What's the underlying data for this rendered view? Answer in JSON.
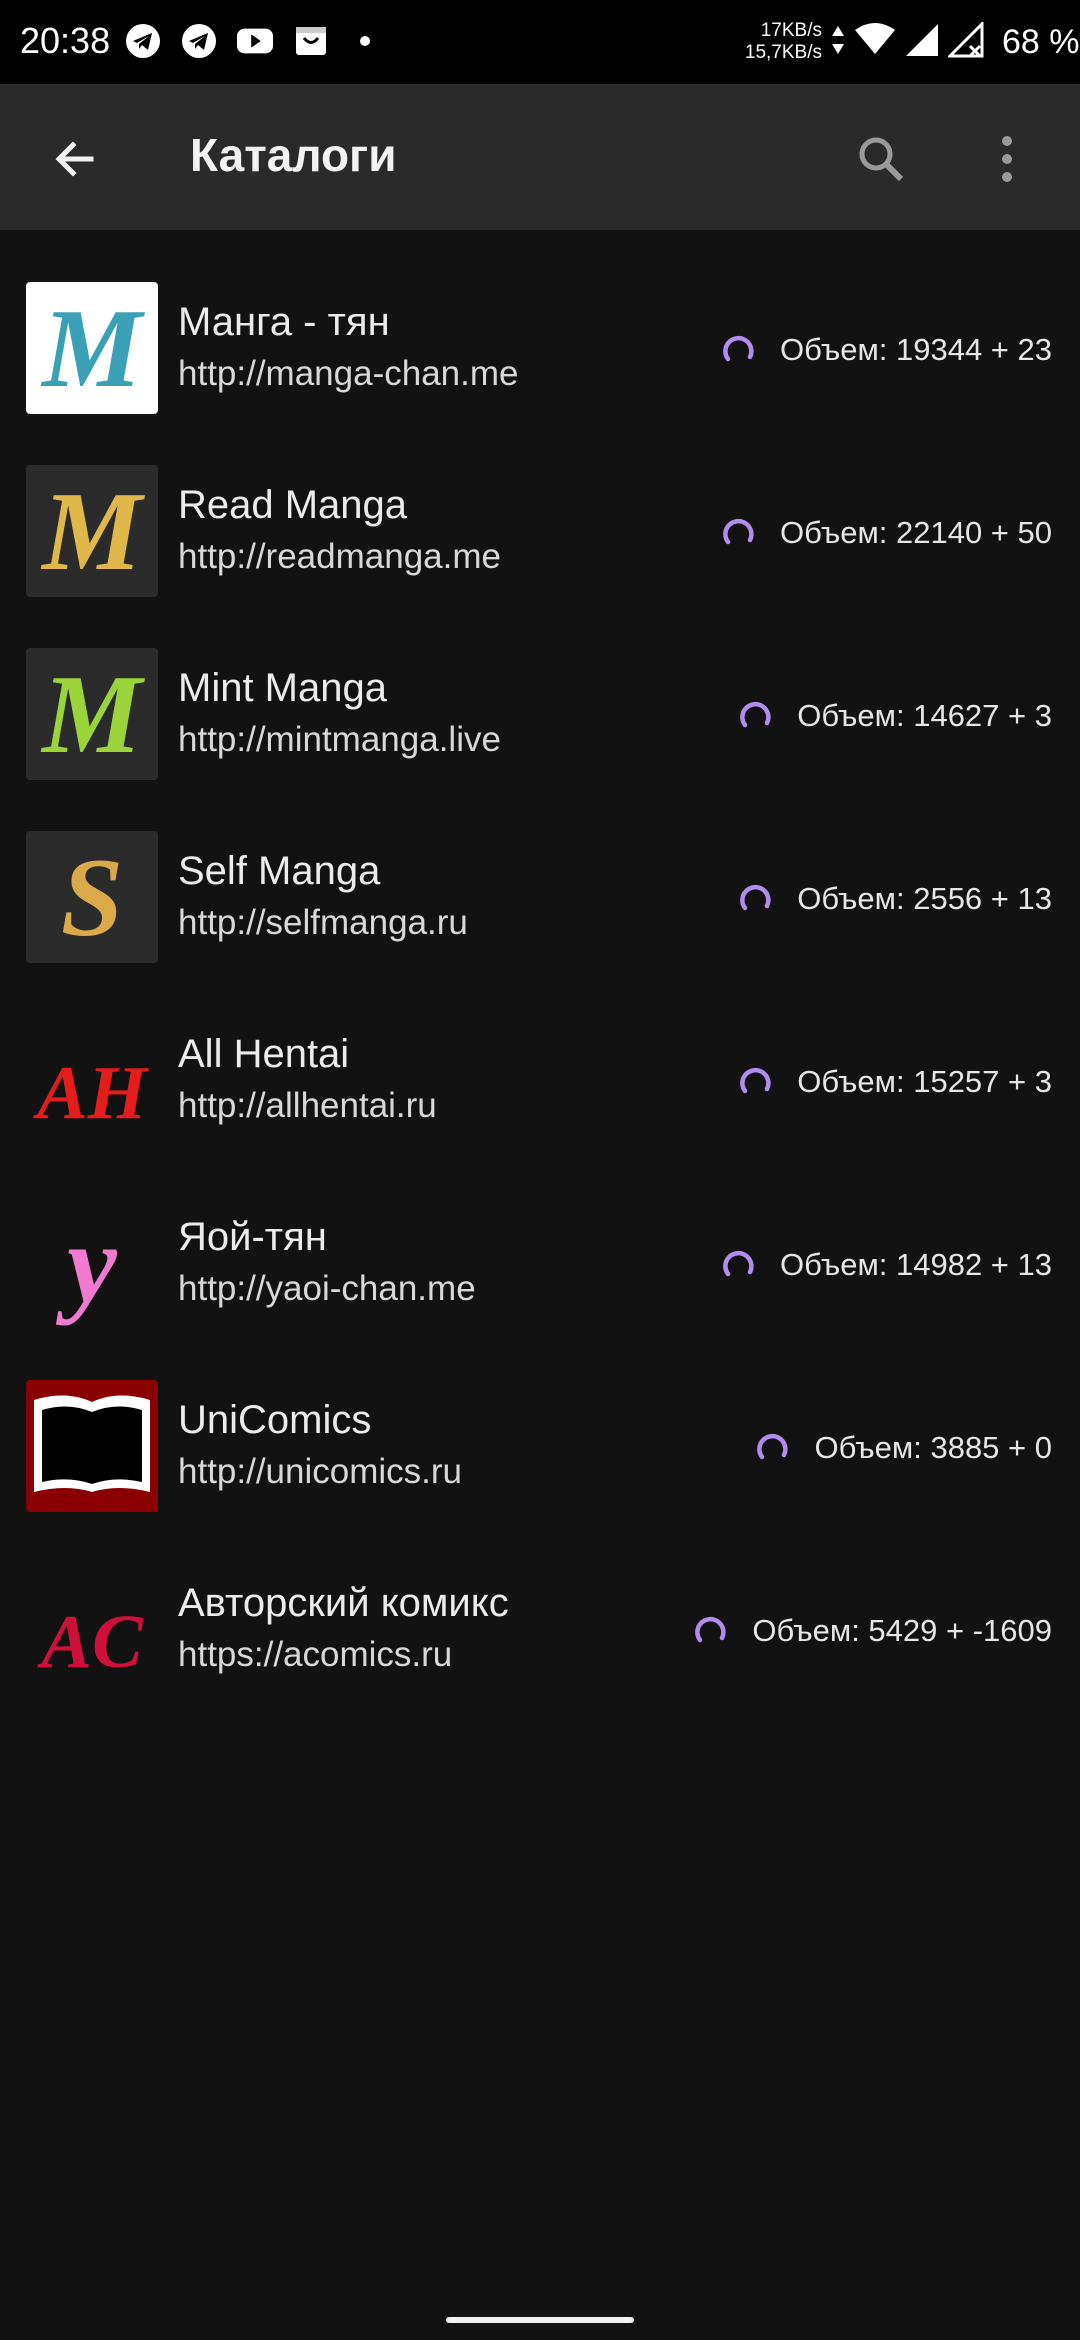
{
  "status_bar": {
    "time": "20:38",
    "net_speed_up": "17KB/s",
    "net_speed_down": "15,7KB/s",
    "battery": "68 %",
    "icons": [
      "telegram-icon",
      "telegram-icon",
      "youtube-icon",
      "shopping-bag-icon",
      "dot-icon",
      "data-arrows-icon",
      "wifi-icon",
      "signal-icon",
      "signal-off-icon"
    ]
  },
  "app_bar": {
    "title": "Каталоги",
    "icons": [
      "back-arrow-icon",
      "search-icon",
      "more-vert-icon"
    ]
  },
  "catalogs": [
    {
      "name": "Манга - тян",
      "url": "http://manga-chan.me",
      "volume": "Объем: 19344 + 23",
      "logo_text": "M",
      "logo_color": "#3aa0b8",
      "logo_bg": "#ffffff"
    },
    {
      "name": "Read Manga",
      "url": "http://readmanga.me",
      "volume": "Объем: 22140 + 50",
      "logo_text": "M",
      "logo_color": "#e0b84a",
      "logo_bg": "#2b2b2b"
    },
    {
      "name": "Mint Manga",
      "url": "http://mintmanga.live",
      "volume": "Объем: 14627 + 3",
      "logo_text": "M",
      "logo_color": "#9ad33a",
      "logo_bg": "#2b2b2b"
    },
    {
      "name": "Self Manga",
      "url": "http://selfmanga.ru",
      "volume": "Объем: 2556 + 13",
      "logo_text": "S",
      "logo_color": "#d9a94a",
      "logo_bg": "#2b2b2b"
    },
    {
      "name": "All Hentai",
      "url": "http://allhentai.ru",
      "volume": "Объем: 15257 + 3",
      "logo_text": "AH",
      "logo_color": "#e41c1c",
      "logo_bg": "#121212"
    },
    {
      "name": "Яой-тян",
      "url": "http://yaoi-chan.me",
      "volume": "Объем: 14982 + 13",
      "logo_text": "y",
      "logo_color": "#f07ad0",
      "logo_bg": "#121212"
    },
    {
      "name": "UniComics",
      "url": "http://unicomics.ru",
      "volume": "Объем: 3885 + 0",
      "logo_text": "",
      "logo_color": "#8a0000",
      "logo_bg": "#8a0000"
    },
    {
      "name": "Авторский комикс",
      "url": "https://acomics.ru",
      "volume": "Объем: 5429 + -1609",
      "logo_text": "AC",
      "logo_color": "#d0103a",
      "logo_bg": "#121212"
    }
  ],
  "colors": {
    "spinner": "#b38cf0",
    "background": "#121212",
    "app_bar": "#2a2a2a"
  }
}
